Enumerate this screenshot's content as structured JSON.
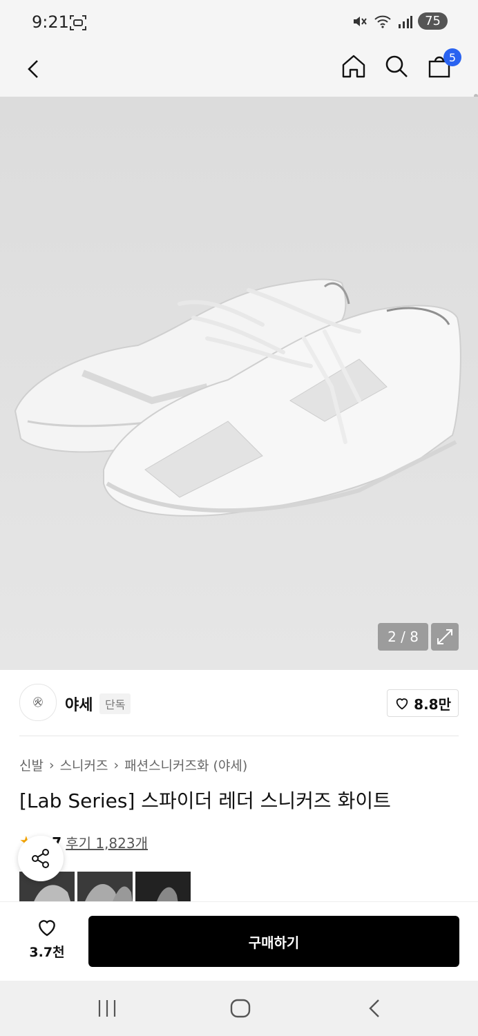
{
  "status": {
    "time": "9:21",
    "battery": "75"
  },
  "topbar": {
    "cart_count": "5"
  },
  "gallery": {
    "counter": "2 / 8"
  },
  "brand": {
    "name": "야세",
    "logo_text": "㊋",
    "tag": "단독",
    "likes": "8.8만"
  },
  "breadcrumb": [
    "신발",
    "스니커즈",
    "패션스니커즈화 (야세)"
  ],
  "product": {
    "title": "[Lab Series] 스파이더 레더 스니커즈 화이트",
    "rating": "4.7",
    "reviews": "후기 1,823개"
  },
  "buybar": {
    "wish_count": "3.7천",
    "buy_label": "구매하기"
  },
  "colors": {
    "badge": "#2a63f0",
    "star": "#f7a600",
    "buy_bg": "#000000"
  }
}
